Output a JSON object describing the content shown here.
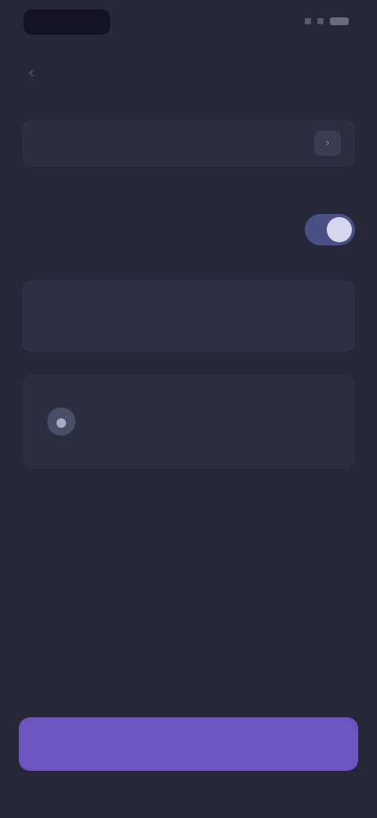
{
  "status_bar": {
    "time": "",
    "icons": [
      "signal-icon",
      "wifi-icon",
      "battery-icon"
    ]
  },
  "nav": {
    "back_icon": "chevron-left-icon",
    "title": ""
  },
  "sections": {
    "account_label": "",
    "settings_label": "",
    "notes_label": ""
  },
  "account": {
    "name": "",
    "chevron_icon": "chevron-right-icon"
  },
  "toggle": {
    "label": "",
    "state": "on"
  },
  "notes": {
    "value": ""
  },
  "card": {
    "icon": "avatar-icon",
    "title": "",
    "action": ""
  },
  "primary_button": {
    "label": ""
  },
  "colors": {
    "background": "#262838",
    "surface": "#2c2f42",
    "accent": "#6b55c0",
    "toggle_on": "#4a4f86"
  }
}
